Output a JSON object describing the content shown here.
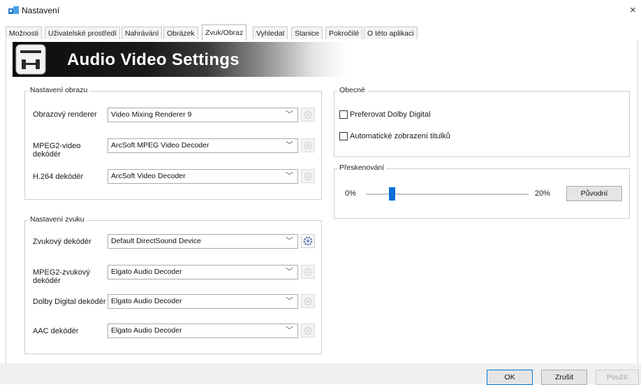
{
  "window": {
    "title": "Nastavení",
    "close": "×"
  },
  "tabs": [
    {
      "label": "Možnosti"
    },
    {
      "label": "Uživatelské prostředí"
    },
    {
      "label": "Nahrávání"
    },
    {
      "label": "Obrázek"
    },
    {
      "label": "Zvuk/Obraz",
      "active": true
    },
    {
      "label": "Vyhledat"
    },
    {
      "label": "Stanice"
    },
    {
      "label": "Pokročilé"
    },
    {
      "label": "O této aplikaci"
    }
  ],
  "banner": {
    "title": "Audio Video Settings"
  },
  "video": {
    "label": "Nastavení obrazu",
    "rows": [
      {
        "label": "Obrazový renderer",
        "value": "Video Mixing Renderer 9"
      },
      {
        "label": "MPEG2-video\ndekódér",
        "value": "ArcSoft MPEG Video Decoder"
      },
      {
        "label": "H.264 dekódér",
        "value": "ArcSoft Video Decoder"
      }
    ]
  },
  "audio": {
    "label": "Nastavení zvuku",
    "rows": [
      {
        "label": "Zvukový dekódér",
        "value": "Default DirectSound Device"
      },
      {
        "label": "MPEG2-zvukový\ndekódér",
        "value": "Elgato Audio Decoder"
      },
      {
        "label": "Dolby Digital dekódér",
        "value": "Elgato Audio Decoder"
      },
      {
        "label": "AAC dekódér",
        "value": "Elgato Audio Decoder"
      }
    ]
  },
  "general": {
    "label": "Obecné",
    "prefer_dolby": "Preferovat Dolby Digital",
    "auto_subtitles": "Automatické zobrazení titulků"
  },
  "overscan": {
    "label": "Přeskenování",
    "min_label": "0%",
    "max_label": "20%",
    "value_fraction": 0.16,
    "reset_label": "Původní"
  },
  "footer": {
    "ok": "OK",
    "cancel": "Zrušit",
    "apply": "Použít"
  },
  "colors": {
    "accent": "#0a6fd6",
    "primary_border": "#0078d7"
  }
}
